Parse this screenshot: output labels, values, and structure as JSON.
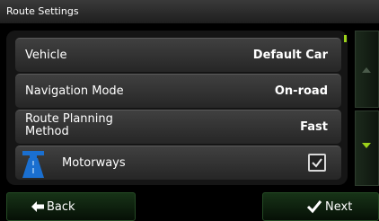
{
  "title": "Route Settings",
  "settings": [
    {
      "label": "Vehicle",
      "value": "Default Car"
    },
    {
      "label": "Navigation Mode",
      "value": "On-road"
    },
    {
      "label": "Route Planning Method",
      "value": "Fast"
    },
    {
      "label": "Motorways",
      "checked": true,
      "icon": "motorway-icon"
    }
  ],
  "nav": {
    "back_label": "Back",
    "next_label": "Next"
  },
  "colors": {
    "accent": "#9cd21a",
    "background": "#000000",
    "row": "#333333",
    "motorway": "#1a6fd0"
  },
  "icons": {
    "scroll_up": "triangle-up-icon",
    "scroll_down": "triangle-down-icon",
    "back": "arrow-left-icon",
    "next": "checkmark-icon",
    "checkbox": "checkmark-icon"
  }
}
